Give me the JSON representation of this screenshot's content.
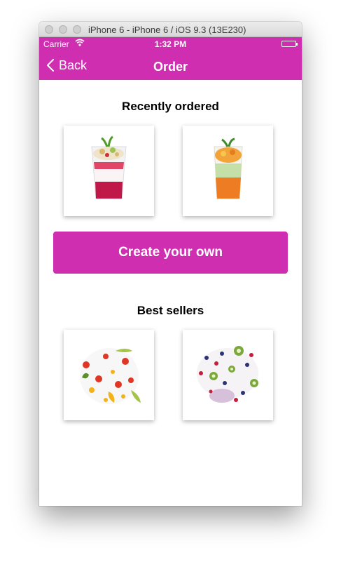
{
  "window": {
    "title": "iPhone 6 - iPhone 6 / iOS 9.3 (13E230)"
  },
  "status_bar": {
    "carrier": "Carrier",
    "time": "1:32 PM",
    "wifi_icon": "wifi-icon",
    "battery_icon": "battery-icon"
  },
  "nav": {
    "back_label": "Back",
    "title": "Order",
    "back_icon": "chevron-left-icon"
  },
  "recent": {
    "title": "Recently ordered",
    "items": [
      {
        "image": "berry-parfait-cup-image"
      },
      {
        "image": "mango-parfait-cup-image"
      }
    ]
  },
  "cta": {
    "label": "Create your own"
  },
  "best": {
    "title": "Best sellers",
    "items": [
      {
        "image": "fruit-salad-yogurt-image"
      },
      {
        "image": "kiwi-berry-yogurt-image"
      }
    ]
  },
  "colors": {
    "accent": "#d02eb1",
    "background": "#ffffff",
    "text": "#000000"
  }
}
